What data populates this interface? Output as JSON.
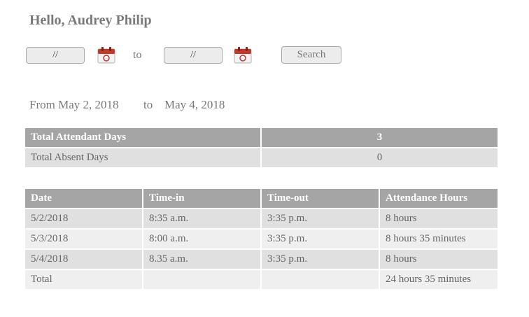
{
  "greeting": "Hello, Audrey Philip",
  "filter": {
    "from_value": "//",
    "to_value": "//",
    "to_label": "to",
    "search_label": "Search"
  },
  "range": {
    "from_label": "From May 2, 2018",
    "to_label": "to",
    "to_date": "May 4, 2018"
  },
  "summary": {
    "rows": [
      {
        "label": "Total Attendant Days",
        "value": "3"
      },
      {
        "label": "Total Absent Days",
        "value": "0"
      }
    ]
  },
  "attendance": {
    "headers": [
      "Date",
      "Time-in",
      "Time-out",
      "Attendance Hours"
    ],
    "rows": [
      [
        "5/2/2018",
        "8:35 a.m.",
        "3:35 p.m.",
        "8 hours"
      ],
      [
        "5/3/2018",
        "8:00 a.m.",
        "3:35 p.m.",
        "8 hours 35 minutes"
      ],
      [
        "5/4/2018",
        "8.35 a.m.",
        "3:35 p.m.",
        "8 hours"
      ]
    ],
    "total": [
      "Total",
      "",
      "",
      "24 hours 35 minutes"
    ]
  },
  "icons": {
    "calendar": "calendar-icon",
    "calendar_color": "#c0392b"
  }
}
